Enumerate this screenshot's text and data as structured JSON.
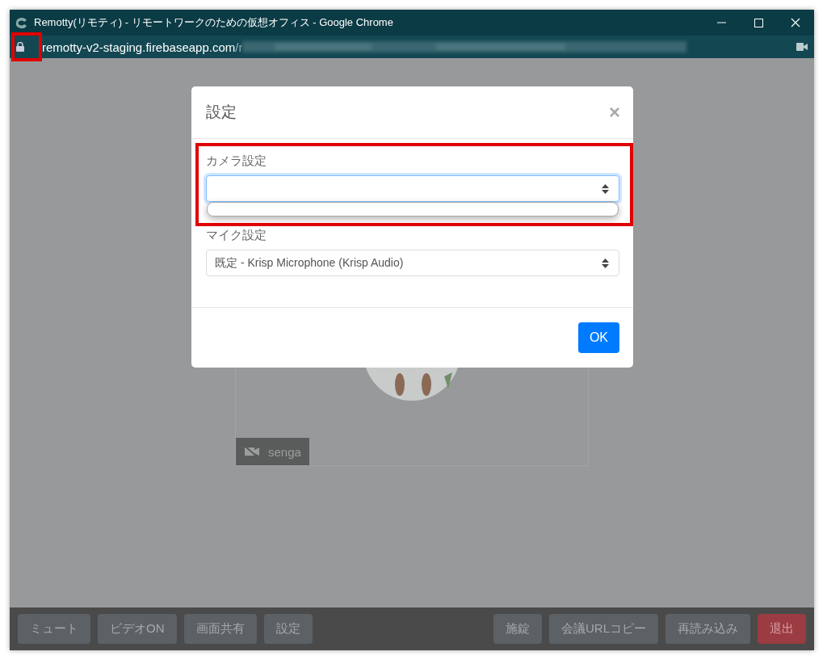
{
  "window": {
    "title": "Remotty(リモティ) - リモートワークのための仮想オフィス - Google Chrome"
  },
  "address_bar": {
    "host": "remotty-v2-staging.firebaseapp.com",
    "path": "/r"
  },
  "modal": {
    "title": "設定",
    "close": "×",
    "fields": [
      {
        "label": "カメラ設定",
        "focused": true,
        "expanded": true
      },
      {
        "label": "マイク設定",
        "value": "既定 - Krisp Microphone (Krisp Audio)",
        "focused": false,
        "expanded": false
      }
    ],
    "ok": "OK"
  },
  "tile": {
    "name": "senga",
    "video_on": false
  },
  "toolbar": {
    "left": [
      {
        "label": "ミュート",
        "kind": "normal"
      },
      {
        "label": "ビデオON",
        "kind": "normal"
      },
      {
        "label": "画面共有",
        "kind": "normal"
      },
      {
        "label": "設定",
        "kind": "normal"
      }
    ],
    "right": [
      {
        "label": "施錠",
        "kind": "normal"
      },
      {
        "label": "会議URLコピー",
        "kind": "normal"
      },
      {
        "label": "再読み込み",
        "kind": "normal"
      },
      {
        "label": "退出",
        "kind": "danger"
      }
    ]
  }
}
